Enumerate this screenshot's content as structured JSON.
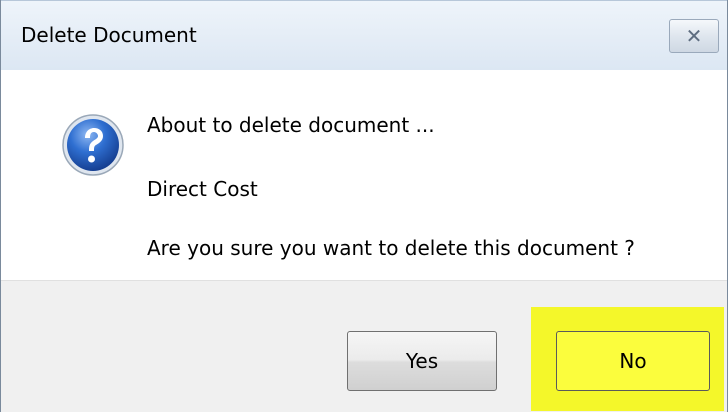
{
  "window": {
    "title": "Delete Document",
    "close_glyph": "✕"
  },
  "message": {
    "icon": "question-icon",
    "line1": "About to delete document ...",
    "line2": "Direct Cost",
    "line3": "Are you sure you want to delete this document ?"
  },
  "buttons": {
    "yes_label": "Yes",
    "no_label": "No"
  },
  "colors": {
    "highlight": "#f4f72a",
    "icon_blue": "#1c57b8"
  }
}
